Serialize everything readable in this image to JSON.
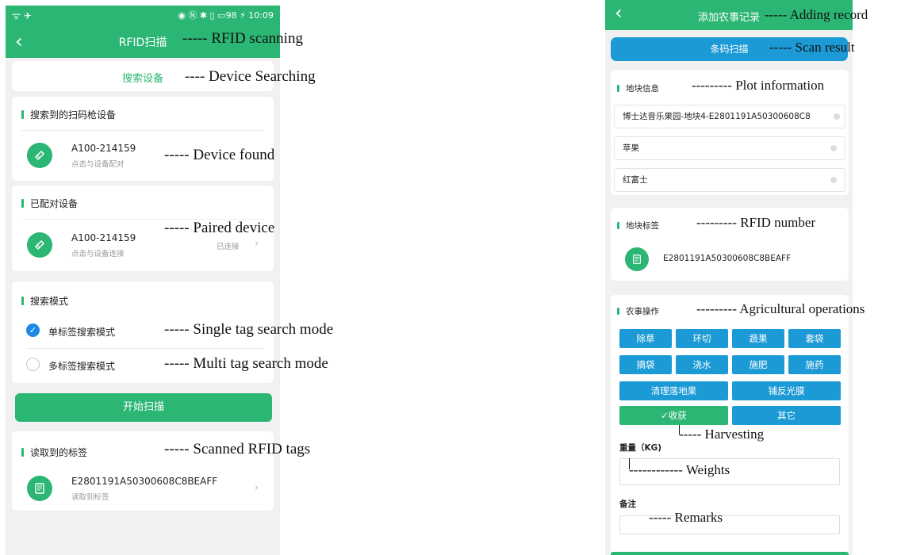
{
  "left_phone": {
    "status": {
      "left_icons": "ᯤ ✈",
      "right_icons": "◉ Ⓝ ✱ ▯ ▭98 ⚡",
      "time": "10:09"
    },
    "title": "RFID扫描",
    "search_device_label": "搜索设备",
    "found_section": {
      "title": "搜索到的扫码枪设备",
      "device_name": "A100-214159",
      "device_sub": "点击与设备配对"
    },
    "paired_section": {
      "title": "已配对设备",
      "device_name": "A100-214159",
      "device_sub": "点击与设备连接",
      "status": "已连接"
    },
    "mode_section": {
      "title": "搜索模式",
      "single_label": "单标签搜索模式",
      "multi_label": "多标签搜索模式"
    },
    "start_button": "开始扫描",
    "tags_section": {
      "title": "读取到的标签",
      "tag_id": "E2801191A50300608C8BEAFF",
      "tag_sub": "读取到标签"
    }
  },
  "right_phone": {
    "title": "添加农事记录",
    "scan_button": "条码扫描",
    "plot_section": {
      "title": "地块信息",
      "field1": "博士达音乐果园-地块4-E2801191A50300608C8",
      "field2": "苹果",
      "field3": "红富士"
    },
    "tag_section": {
      "title": "地块标签",
      "tag_id": "E2801191A50300608C8BEAFF"
    },
    "ops_section": {
      "title": "农事操作",
      "row1": [
        "除草",
        "环切",
        "蔬果",
        "套袋"
      ],
      "row2": [
        "摘袋",
        "浇水",
        "施肥",
        "施药"
      ],
      "row3": [
        "清理落地果",
        "铺反光膜"
      ],
      "harvest": "✓收获",
      "other": "其它"
    },
    "weight_label": "重量（KG)",
    "remarks_label": "备注"
  },
  "annotations": {
    "rfid_scanning": "-----  RFID scanning",
    "device_searching": "----  Device Searching",
    "device_found": "-----  Device found",
    "paired_device": "-----  Paired device",
    "single_mode": "-----  Single tag search mode",
    "multi_mode": "-----  Multi tag search mode",
    "scanned_tags": "-----  Scanned RFID tags",
    "adding_record": "----- Adding record",
    "scan_result": "----- Scan result",
    "plot_info": "---------   Plot information",
    "rfid_number": "---------   RFID number",
    "agri_ops": "---------   Agricultural operations",
    "harvesting": "----- Harvesting",
    "weights": "------------ Weights",
    "remarks": "----- Remarks"
  },
  "colors": {
    "green": "#2bb673",
    "blue": "#1b9ad6",
    "radio_blue": "#1e88e5"
  }
}
